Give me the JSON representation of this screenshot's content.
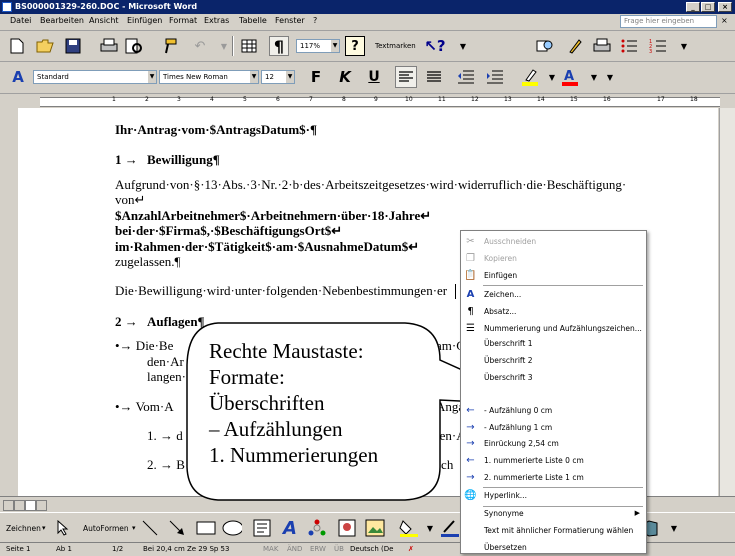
{
  "window": {
    "title": "BS000001329-260.DOC - Microsoft Word"
  },
  "menu": {
    "items": [
      "Datei",
      "Bearbeiten",
      "Ansicht",
      "Einfügen",
      "Format",
      "Extras",
      "Tabelle",
      "Fenster",
      "?"
    ],
    "help_placeholder": "Frage hier eingeben"
  },
  "toolbar": {
    "zoom": "117%",
    "textmarken": "Textmarken"
  },
  "format_bar": {
    "style": "Standard",
    "font": "Times New Roman",
    "size": "12",
    "bold": "F",
    "italic": "K",
    "underline": "U"
  },
  "ruler": {
    "labels": [
      "1",
      "2",
      "3",
      "4",
      "5",
      "6",
      "7",
      "8",
      "9",
      "10",
      "11",
      "12",
      "13",
      "14",
      "15",
      "16",
      "17",
      "18"
    ]
  },
  "document": {
    "line1": "Ihr·Antrag·vom·$AntragsDatum$·¶",
    "heading1_num": "1 →",
    "heading1": "Bewilligung¶",
    "para1_line1": "Aufgrund·von·§·13·Abs.·3·Nr.·2·b·des·Arbeitszeitgesetzes·wird·widerruflich·die·Beschäftigung·",
    "para1_line2": "von↵",
    "para1_line3": "$AnzahlArbeitnehmer$·Arbeitnehmern·über·18·Jahre↵",
    "para1_line4": "bei·der·$Firma$,·$BeschäftigungsOrt$↵",
    "para1_line5": "im·Rahmen·der·$Tätigkeit$·am·$AusnahmeDatum$↵",
    "para1_line6": "zugelassen.¶",
    "para2": "Die·Bewilligung·wird·unter·folgenden·Nebenbestimmungen·er",
    "heading2_num": "2 →",
    "heading2": "Auflagen¶",
    "bullet1_line1": "•→ Die·Be",
    "bullet1_line1_end": "am·G",
    "bullet1_line2": "den·Ar",
    "bullet1_line3": "langen·",
    "bullet2_line1": "•→ Vom·A",
    "bullet2_line1_end": "Anga",
    "numbered1": "1. → d",
    "numbered1_end": "ten·A",
    "numbered2": "2. → B",
    "numbered2_end": "sch"
  },
  "callout": {
    "lines": [
      "Rechte Maustaste:",
      "Formate:",
      "Überschriften",
      "– Aufzählungen",
      "1. Nummerierungen"
    ]
  },
  "context_menu": {
    "items": [
      {
        "label": "Ausschneiden",
        "icon": "scissors-icon",
        "disabled": true
      },
      {
        "label": "Kopieren",
        "icon": "copy-icon",
        "disabled": true
      },
      {
        "label": "Einfügen",
        "icon": "paste-icon",
        "disabled": false
      },
      {
        "separator": true
      },
      {
        "label": "Zeichen...",
        "icon": "font-icon",
        "disabled": false
      },
      {
        "label": "Absatz...",
        "icon": "paragraph-icon",
        "disabled": false
      },
      {
        "label": "Nummerierung und Aufzählungszeichen...",
        "icon": "list-icon",
        "disabled": false
      },
      {
        "label": "Überschrift 1",
        "icon": "",
        "disabled": false
      },
      {
        "label": "Überschrift 2",
        "icon": "",
        "disabled": false
      },
      {
        "label": "Überschrift 3",
        "icon": "",
        "disabled": false
      },
      {
        "label": "",
        "icon": "",
        "disabled": false
      },
      {
        "label": "- Aufzählung 0 cm",
        "icon": "arrow-left-icon",
        "disabled": false
      },
      {
        "label": "- Aufzählung 1 cm",
        "icon": "arrow-right-icon",
        "disabled": false
      },
      {
        "label": "Einrückung 2,54 cm",
        "icon": "arrow-right-icon",
        "disabled": false
      },
      {
        "label": "1. nummerierte Liste 0 cm",
        "icon": "arrow-left-icon",
        "disabled": false
      },
      {
        "label": "2. nummerierte Liste 1 cm",
        "icon": "arrow-right-icon",
        "disabled": false
      },
      {
        "separator": true
      },
      {
        "label": "Hyperlink...",
        "icon": "globe-icon",
        "disabled": false
      },
      {
        "separator": true
      },
      {
        "label": "Synonyme",
        "icon": "",
        "disabled": false,
        "submenu": true
      },
      {
        "label": "Text mit ähnlicher Formatierung wählen",
        "icon": "",
        "disabled": false
      },
      {
        "label": "Übersetzen",
        "icon": "",
        "disabled": false
      }
    ]
  },
  "drawing_bar": {
    "zeichnen": "Zeichnen",
    "autoformen": "AutoFormen"
  },
  "status": {
    "page": "Seite 1",
    "section": "Ab 1",
    "pages": "1/2",
    "position": "Bei 20,4 cm  Ze 29  Sp 53",
    "modes": [
      "MAK",
      "ÄND",
      "ERW",
      "ÜB"
    ],
    "language": "Deutsch (De"
  },
  "colors": {
    "title_bar": "#0a246a",
    "menu_bg": "#d4d0c8",
    "highlight": "#ffff00",
    "font_color": "#ff0000"
  }
}
